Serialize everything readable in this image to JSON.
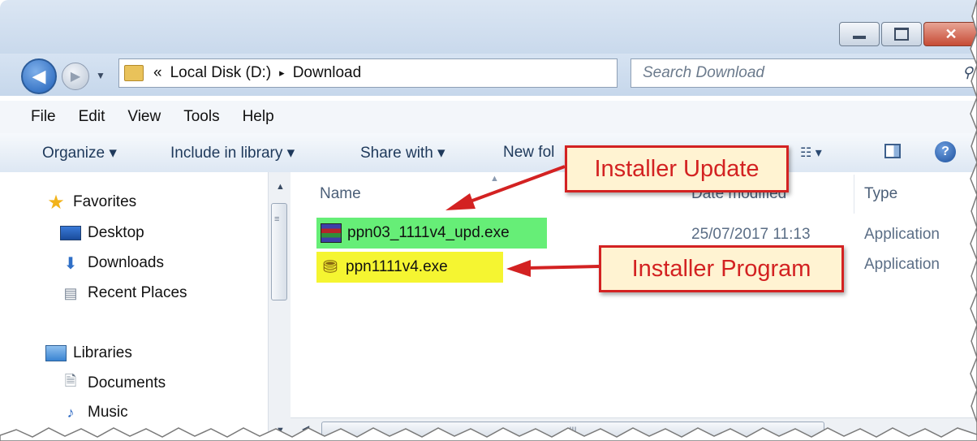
{
  "address": {
    "crumbs": [
      "«",
      "Local Disk (D:)",
      "▸",
      "Download"
    ],
    "search_placeholder": "Search Download"
  },
  "menu": [
    "File",
    "Edit",
    "View",
    "Tools",
    "Help"
  ],
  "toolbar": {
    "organize": "Organize ▾",
    "include_in_library": "Include in library ▾",
    "share_with": "Share with ▾",
    "new_folder": "New fol"
  },
  "nav": {
    "favorites": "Favorites",
    "desktop": "Desktop",
    "downloads": "Downloads",
    "recent_places": "Recent Places",
    "libraries": "Libraries",
    "documents": "Documents",
    "music": "Music"
  },
  "columns": {
    "name": "Name",
    "date_modified": "Date modified",
    "type": "Type"
  },
  "files": [
    {
      "name": "ppn03_1111v4_upd.exe",
      "date": "25/07/2017 11:13",
      "type": "Application",
      "highlight": "#66ee77"
    },
    {
      "name": "ppn1111v4.exe",
      "date": "",
      "type": "Application",
      "highlight": "#f5f531"
    }
  ],
  "callouts": {
    "update": "Installer Update",
    "program": "Installer Program",
    "color": "#d32222",
    "fill": "#fff3d2"
  }
}
